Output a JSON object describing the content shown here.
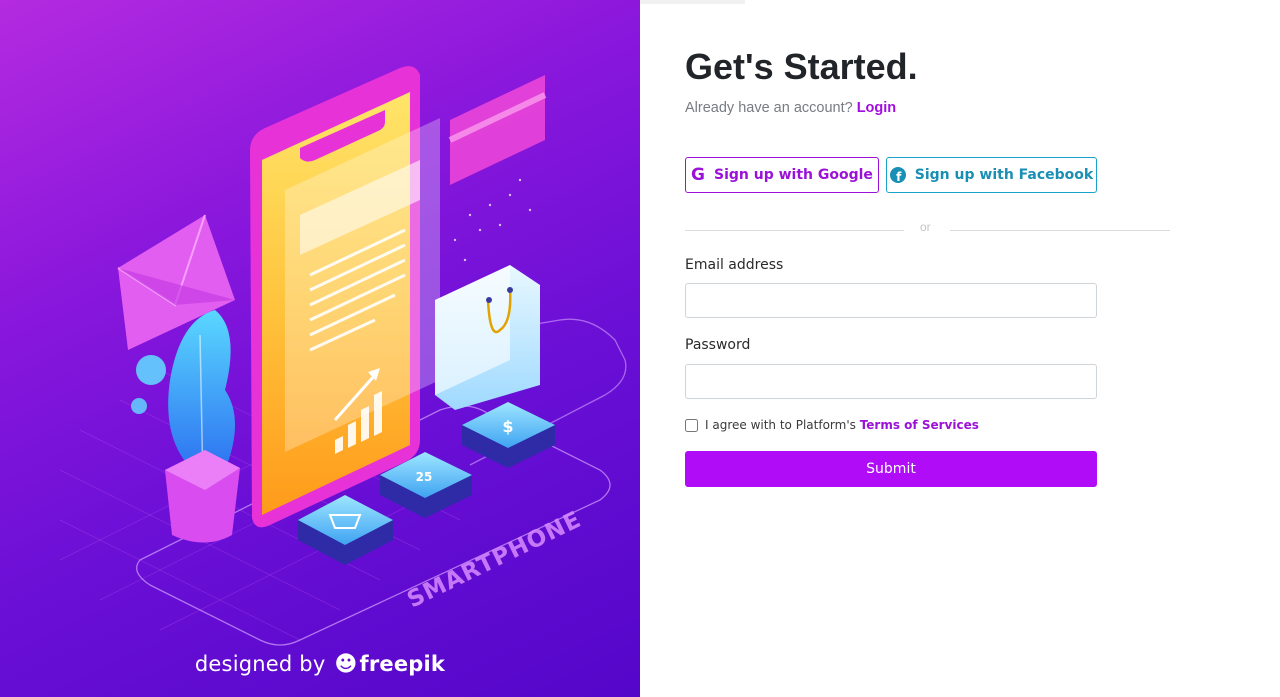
{
  "page": {
    "title": "Get's Started.",
    "account_prompt": "Already have an account?",
    "login_label": "Login"
  },
  "social": {
    "google_label": "Sign up with Google",
    "google_icon": "G",
    "facebook_label": "Sign up with Facebook",
    "facebook_icon": "f"
  },
  "divider": {
    "text": "or"
  },
  "form": {
    "email_label": "Email address",
    "email_value": "",
    "password_label": "Password",
    "password_value": "",
    "agree_text": "I agree with to Platform's",
    "terms_label": "Terms of Services",
    "agree_checked": false,
    "submit_label": "Submit"
  },
  "illustration": {
    "phone_label": "SMARTPHONE",
    "calendar_day": "25",
    "coin_symbol": "$",
    "credit_prefix": "designed by",
    "credit_brand": "freepik",
    "credit_icon": "freepik-logo-icon"
  },
  "colors": {
    "accent": "#b00cf7",
    "google_border": "#9b11d8",
    "facebook_border": "#19a3c9",
    "hero_top": "#b42be0",
    "hero_bottom": "#5406c9"
  }
}
